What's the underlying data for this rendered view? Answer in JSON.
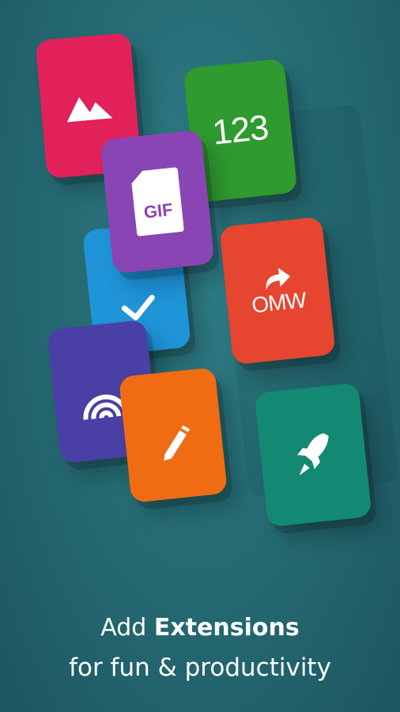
{
  "tiles": {
    "photos": {
      "icon": "mountain-icon",
      "color": "#e2215a"
    },
    "numbers": {
      "label": "123",
      "color": "#2f9a2f"
    },
    "gif": {
      "label": "GIF",
      "icon": "gif-file-icon",
      "color": "#8a45b4"
    },
    "check": {
      "icon": "checkmark-icon",
      "color": "#1f94d8"
    },
    "omw": {
      "label": "OMW",
      "icon": "share-arrow-icon",
      "color": "#e64530"
    },
    "signal": {
      "icon": "rainbow-arc-icon",
      "color": "#4a3fa4"
    },
    "draw": {
      "icon": "pencil-icon",
      "color": "#f06c13"
    },
    "launch": {
      "icon": "rocket-icon",
      "color": "#138973"
    }
  },
  "caption": {
    "line1_prefix": "Add",
    "line1_bold": "Extensions",
    "line2": "for fun & productivity"
  }
}
